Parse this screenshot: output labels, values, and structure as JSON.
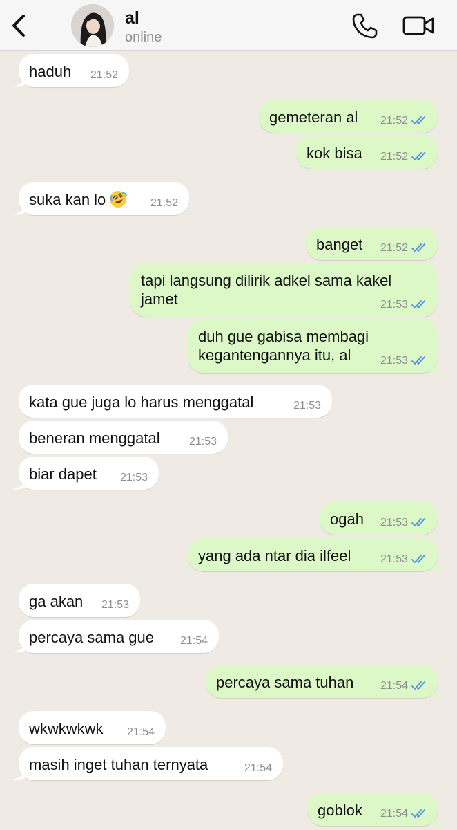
{
  "header": {
    "contact_name": "al",
    "status": "online",
    "icons": {
      "back": "chevron-left-icon",
      "call": "phone-icon",
      "video": "video-camera-icon"
    }
  },
  "colors": {
    "background": "#efeae4",
    "incoming_bubble": "#ffffff",
    "outgoing_bubble": "#dcf8c6",
    "read_ticks": "#4a90e2"
  },
  "messages": [
    {
      "dir": "in",
      "text": "haduh",
      "time": "21:52"
    },
    {
      "dir": "out",
      "text": "gemeteran al",
      "time": "21:52"
    },
    {
      "dir": "out",
      "text": "kok bisa",
      "time": "21:52"
    },
    {
      "dir": "in",
      "text": "suka kan lo",
      "time": "21:52",
      "emoji": "rolling-on-floor-laughing-emoji"
    },
    {
      "dir": "out",
      "text": "banget",
      "time": "21:52"
    },
    {
      "dir": "out",
      "text": "tapi langsung dilirik adkel sama kakel\njamet",
      "time": "21:53"
    },
    {
      "dir": "out",
      "text": "duh gue gabisa membagi\nkegantengannya itu, al",
      "time": "21:53"
    },
    {
      "dir": "in",
      "text": "kata gue juga lo harus menggatal",
      "time": "21:53"
    },
    {
      "dir": "in",
      "text": "beneran menggatal",
      "time": "21:53"
    },
    {
      "dir": "in",
      "text": "biar dapet",
      "time": "21:53"
    },
    {
      "dir": "out",
      "text": "ogah",
      "time": "21:53"
    },
    {
      "dir": "out",
      "text": "yang ada ntar dia ilfeel",
      "time": "21:53"
    },
    {
      "dir": "in",
      "text": "ga akan",
      "time": "21:53"
    },
    {
      "dir": "in",
      "text": "percaya sama gue",
      "time": "21:54"
    },
    {
      "dir": "out",
      "text": "percaya sama tuhan",
      "time": "21:54"
    },
    {
      "dir": "in",
      "text": "wkwkwkwk",
      "time": "21:54"
    },
    {
      "dir": "in",
      "text": "masih inget tuhan ternyata",
      "time": "21:54"
    },
    {
      "dir": "out",
      "text": "goblok",
      "time": "21:54"
    }
  ]
}
